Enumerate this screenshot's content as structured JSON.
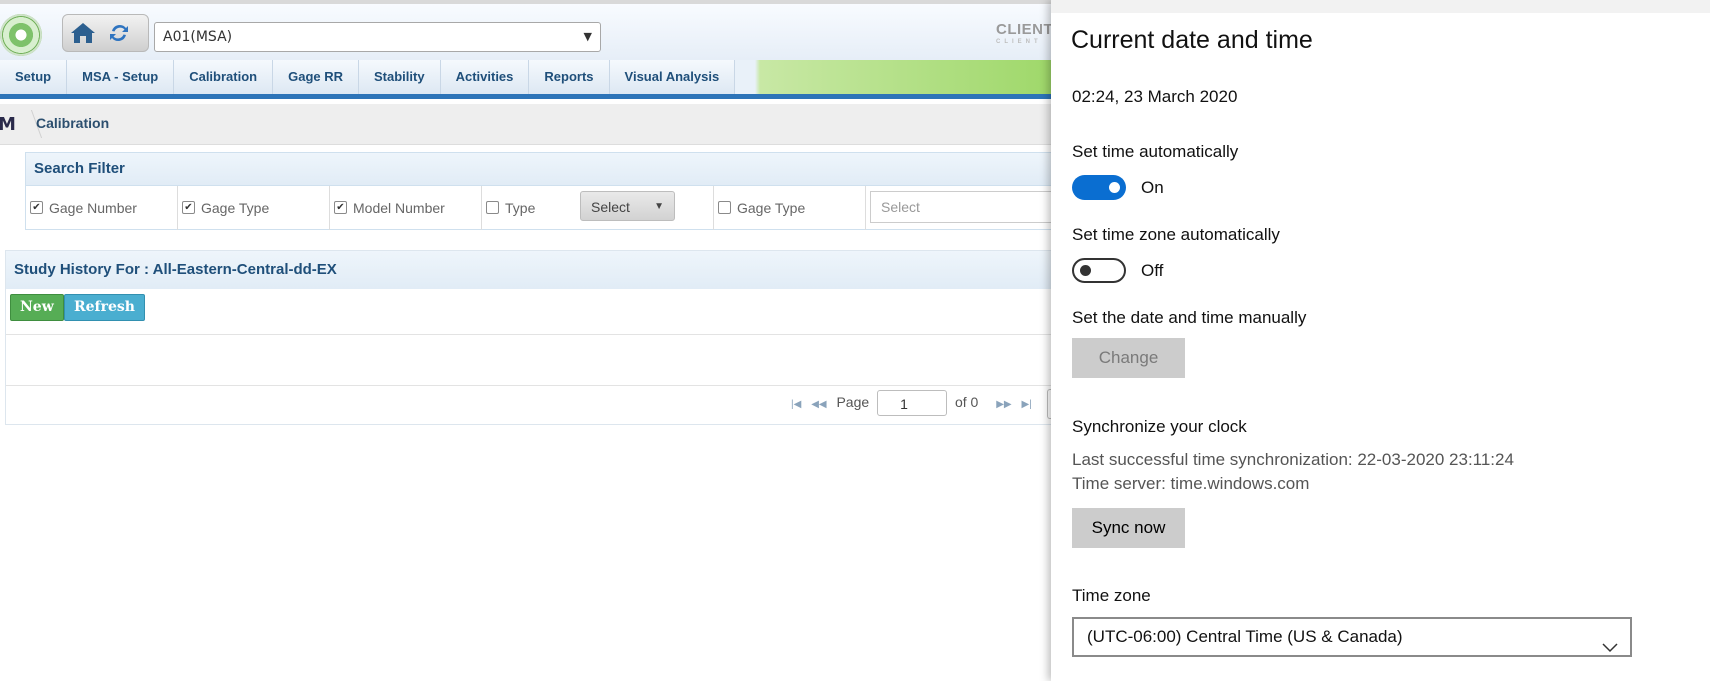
{
  "app": {
    "project_select": "A01(MSA)",
    "client_logo": {
      "main": "CLIENT",
      "sub": "CLIENT"
    },
    "nav": [
      "Setup",
      "MSA - Setup",
      "Calibration",
      "Gage RR",
      "Stability",
      "Activities",
      "Reports",
      "Visual Analysis"
    ],
    "breadcrumb": {
      "icon_letter": "M",
      "label": "Calibration"
    },
    "search_filter": {
      "title": "Search Filter",
      "fields": [
        {
          "label": "Gage Number",
          "checked": true
        },
        {
          "label": "Gage Type",
          "checked": true
        },
        {
          "label": "Model Number",
          "checked": true
        },
        {
          "label": "Type",
          "checked": false
        },
        {
          "label": "Gage Type",
          "checked": false
        }
      ],
      "type_select": "Select",
      "gage_type_select_placeholder": "Select"
    },
    "study": {
      "title": "Study History For : All-Eastern-Central-dd-EX",
      "new_label": "New",
      "refresh_label": "Refresh",
      "pager": {
        "page_label": "Page",
        "page_value": "1",
        "of_label": "of 0"
      }
    }
  },
  "settings": {
    "title": "Current date and time",
    "now": "02:24, 23 March 2020",
    "auto_time": {
      "label": "Set time automatically",
      "state": "On"
    },
    "auto_zone": {
      "label": "Set time zone automatically",
      "state": "Off"
    },
    "manual": {
      "label": "Set the date and time manually",
      "button": "Change"
    },
    "sync": {
      "label": "Synchronize your clock",
      "last_sync": "Last successful time synchronization: 22-03-2020 23:11:24",
      "server": "Time server: time.windows.com",
      "button": "Sync now"
    },
    "timezone": {
      "label": "Time zone",
      "value": "(UTC-06:00) Central Time (US & Canada)"
    }
  },
  "colors": {
    "toggle_on": "#0a6ed1",
    "nav_accent": "#2d74b8",
    "new_button": "#56ad55",
    "refresh_button": "#4aaed0"
  }
}
